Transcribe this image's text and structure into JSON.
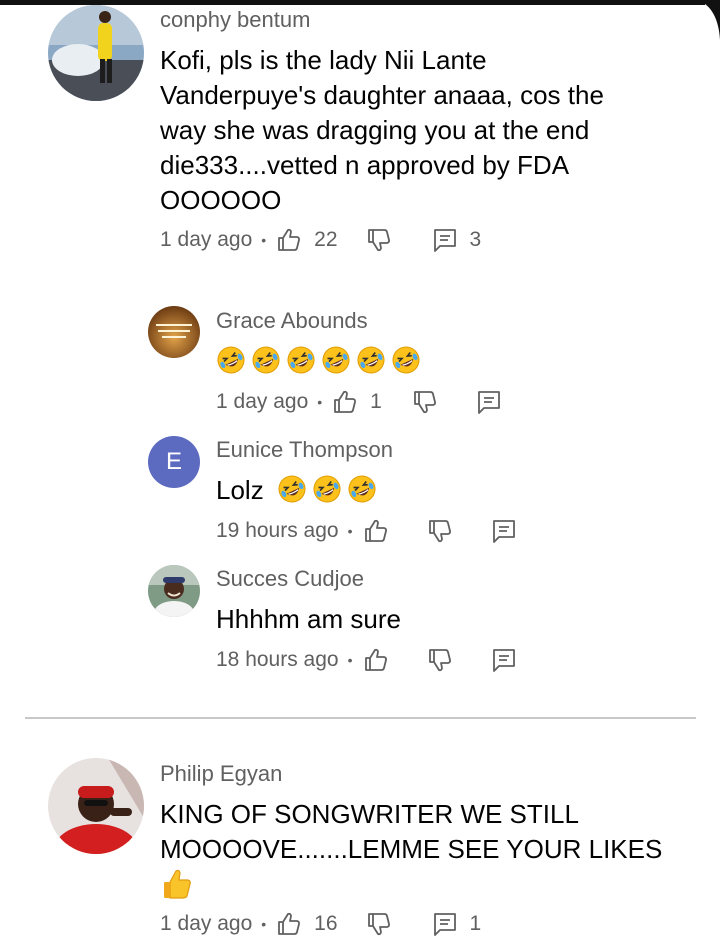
{
  "comments": [
    {
      "author": "conphy bentum",
      "text_lines": [
        "Kofi, pls is the lady Nii Lante",
        "Vanderpuye's daughter anaaa, cos the",
        "way she was dragging you at the end",
        "die333....vetted n approved by FDA",
        "OOOOOO"
      ],
      "time": "1 day ago",
      "likes": "22",
      "replies_count": "3",
      "replies": [
        {
          "author": "Grace Abounds",
          "text": "",
          "emoji_count": 6,
          "time": "1 day ago",
          "likes": "1",
          "avatar_text": "Whatever you do, do it all for the glory of God"
        },
        {
          "author": "Eunice Thompson",
          "text": "Lolz",
          "emoji_count": 3,
          "time": "19 hours ago",
          "likes": "",
          "avatar_letter": "E",
          "avatar_color": "#5c6bc0"
        },
        {
          "author": "Succes Cudjoe",
          "text": "Hhhhm am sure",
          "emoji_count": 0,
          "time": "18 hours ago",
          "likes": ""
        }
      ]
    },
    {
      "author": "Philip Egyan",
      "text_lines": [
        "KING OF SONGWRITER WE STILL",
        "MOOOOVE.......LEMME SEE YOUR LIKES"
      ],
      "emoji": "thumbs-up",
      "time": "1 day ago",
      "likes": "16",
      "replies_count": "1"
    }
  ],
  "icons": {
    "like": "thumb-up-outline-icon",
    "dislike": "thumb-down-outline-icon",
    "reply": "comment-outline-icon",
    "emoji": "rolling-on-floor-laughing"
  }
}
